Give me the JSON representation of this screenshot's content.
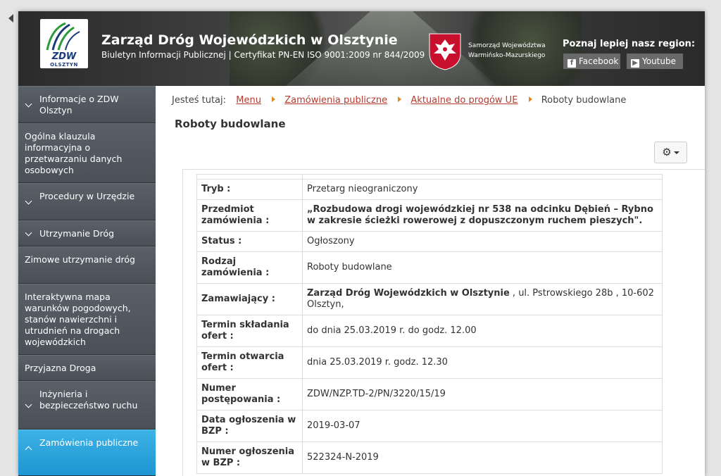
{
  "header": {
    "logo_text": "ZDW",
    "logo_city": "OLSZTYN",
    "title": "Zarząd Dróg Wojewódzkich w Olsztynie",
    "subtitle": "Biuletyn Informacji Publicznej | Certyfikat PN-EN ISO 9001:2009 nr 844/2009",
    "crest_line1": "Samorząd Województwa",
    "crest_line2": "Warmińsko-Mazurskiego",
    "region_title": "Poznaj lepiej nasz region:",
    "facebook_label": "Facebook",
    "youtube_label": "Youtube"
  },
  "sidebar": {
    "items": [
      {
        "label": "Informacje o ZDW Olsztyn"
      },
      {
        "label": "Ogólna klauzula informacyjna o przetwarzaniu danych osobowych"
      },
      {
        "label": "Procedury w Urzędzie"
      },
      {
        "label": "Utrzymanie Dróg"
      },
      {
        "label": "Zimowe utrzymanie dróg"
      },
      {
        "label": "Interaktywna mapa warunków pogodowych, stanów nawierzchni i utrudnień na drogach wojewódzkich"
      },
      {
        "label": "Przyjazna Droga"
      },
      {
        "label": "Inżynieria i bezpieczeństwo ruchu"
      },
      {
        "label": "Zamówienia publiczne"
      }
    ]
  },
  "breadcrumb": {
    "prefix": "Jesteś tutaj:",
    "items": [
      "Menu",
      "Zamówienia publiczne",
      "Aktualne do progów UE"
    ],
    "current": "Roboty budowlane"
  },
  "page_title": "Roboty budowlane",
  "details": {
    "rows": [
      {
        "label": "Tryb :",
        "value": "Przetarg nieograniczony"
      },
      {
        "label": "Przedmiot zamówienia :",
        "value": "„Rozbudowa drogi wojewódzkiej nr 538 na odcinku Dębień – Rybno w zakresie ścieżki rowerowej z dopuszczonym ruchem pieszych\"."
      },
      {
        "label": "Status :",
        "value": "Ogłoszony"
      },
      {
        "label": "Rodzaj zamówienia :",
        "value": "Roboty budowlane"
      },
      {
        "label": "Zamawiający :",
        "value_bold": "Zarząd Dróg Wojewódzkich w Olsztynie",
        "value": " , ul. Pstrowskiego 28b , 10-602 Olsztyn,"
      },
      {
        "label": "Termin składania ofert :",
        "value": "do dnia 25.03.2019 r. do godz. 12.00"
      },
      {
        "label": "Termin otwarcia ofert :",
        "value": "dnia 25.03.2019 r. godz. 12.30"
      },
      {
        "label": "Numer postępowania :",
        "value": "ZDW/NZP.TD-2/PN/3220/15/19"
      },
      {
        "label": "Data ogłoszenia w BZP :",
        "value": "2019-03-07"
      },
      {
        "label": "Numer ogłoszenia w BZP :",
        "value": "522324-N-2019"
      }
    ]
  },
  "icons": {
    "gear": "gear-icon",
    "facebook": "facebook-icon",
    "youtube": "youtube-icon"
  },
  "colors": {
    "active_sidebar": "#2aa3dc",
    "link": "#b33a2f",
    "breadcrumb_arrow": "#e08a1e"
  }
}
